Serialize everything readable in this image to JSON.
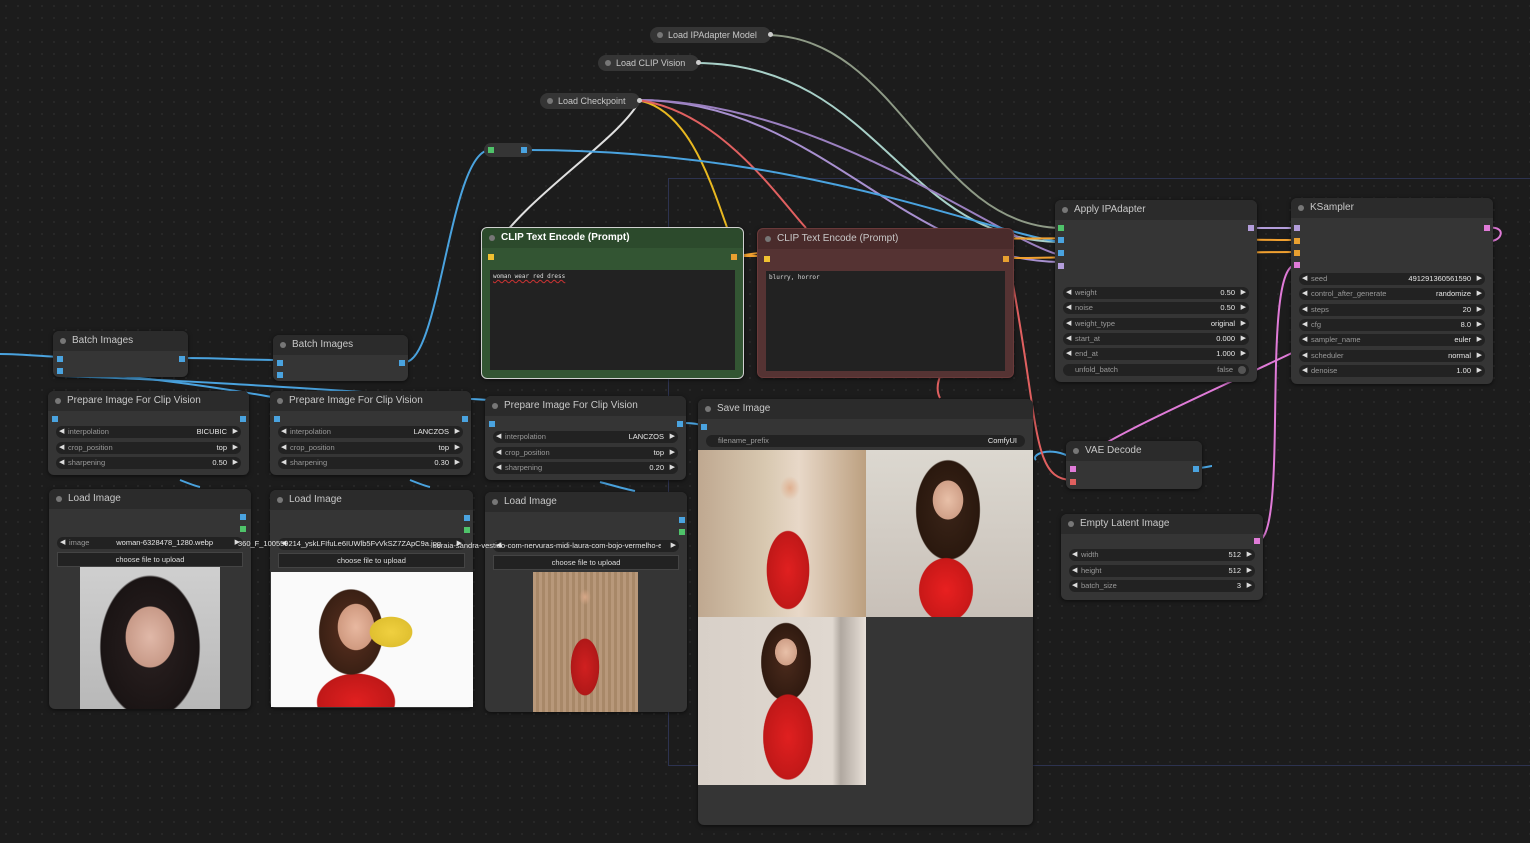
{
  "nodes": {
    "load_ipadapter": {
      "title": "Load IPAdapter Model"
    },
    "load_clip_vision": {
      "title": "Load CLIP Vision"
    },
    "load_checkpoint": {
      "title": "Load Checkpoint"
    },
    "clip_pos": {
      "title": "CLIP Text Encode (Prompt)",
      "text": "woman wear red dress"
    },
    "clip_neg": {
      "title": "CLIP Text Encode (Prompt)",
      "text": "blurry, horror"
    },
    "apply_ipadapter": {
      "title": "Apply IPAdapter",
      "widgets": [
        {
          "label": "weight",
          "value": "0.50"
        },
        {
          "label": "noise",
          "value": "0.50"
        },
        {
          "label": "weight_type",
          "value": "original"
        },
        {
          "label": "start_at",
          "value": "0.000"
        },
        {
          "label": "end_at",
          "value": "1.000"
        },
        {
          "label": "unfold_batch",
          "value": "false"
        }
      ]
    },
    "ksampler": {
      "title": "KSampler",
      "widgets": [
        {
          "label": "seed",
          "value": "491291360561590"
        },
        {
          "label": "control_after_generate",
          "value": "randomize"
        },
        {
          "label": "steps",
          "value": "20"
        },
        {
          "label": "cfg",
          "value": "8.0"
        },
        {
          "label": "sampler_name",
          "value": "euler"
        },
        {
          "label": "scheduler",
          "value": "normal"
        },
        {
          "label": "denoise",
          "value": "1.00"
        }
      ]
    },
    "batch1": {
      "title": "Batch Images"
    },
    "batch2": {
      "title": "Batch Images"
    },
    "prep1": {
      "title": "Prepare Image For Clip Vision",
      "widgets": [
        {
          "label": "interpolation",
          "value": "BICUBIC"
        },
        {
          "label": "crop_position",
          "value": "top"
        },
        {
          "label": "sharpening",
          "value": "0.50"
        }
      ]
    },
    "prep2": {
      "title": "Prepare Image For Clip Vision",
      "widgets": [
        {
          "label": "interpolation",
          "value": "LANCZOS"
        },
        {
          "label": "crop_position",
          "value": "top"
        },
        {
          "label": "sharpening",
          "value": "0.30"
        }
      ]
    },
    "prep3": {
      "title": "Prepare Image For Clip Vision",
      "widgets": [
        {
          "label": "interpolation",
          "value": "LANCZOS"
        },
        {
          "label": "crop_position",
          "value": "top"
        },
        {
          "label": "sharpening",
          "value": "0.20"
        }
      ]
    },
    "load1": {
      "title": "Load Image",
      "image_label": "image",
      "image_value": "woman-6328478_1280.webp",
      "upload": "choose file to upload"
    },
    "load2": {
      "title": "Load Image",
      "image_value": "360_F_100559214_yskLFIfuLe6IUWlb5FvVkSZ7ZApC9a.jpg",
      "upload": "choose file to upload"
    },
    "load3": {
      "title": "Load Image",
      "image_value": "soraia-sandra-vestido-com-nervuras-midi-laura-com-bojo-vermelho-estampado-1200x1616.jpg",
      "upload": "choose file to upload"
    },
    "save": {
      "title": "Save Image",
      "widgets": [
        {
          "label": "filename_prefix",
          "value": "ComfyUI"
        }
      ]
    },
    "vae_decode": {
      "title": "VAE Decode"
    },
    "empty_latent": {
      "title": "Empty Latent Image",
      "widgets": [
        {
          "label": "width",
          "value": "512"
        },
        {
          "label": "height",
          "value": "512"
        },
        {
          "label": "batch_size",
          "value": "3"
        }
      ]
    }
  },
  "colors": {
    "model": "#b39ddb",
    "clip": "#f0c131",
    "vae": "#e0605f",
    "conditioning": "#f0a030",
    "image": "#4aa3df",
    "latent": "#e07bd8",
    "clip_vision": "#a8d8c8",
    "ipadapter": "#9aaa8e"
  }
}
